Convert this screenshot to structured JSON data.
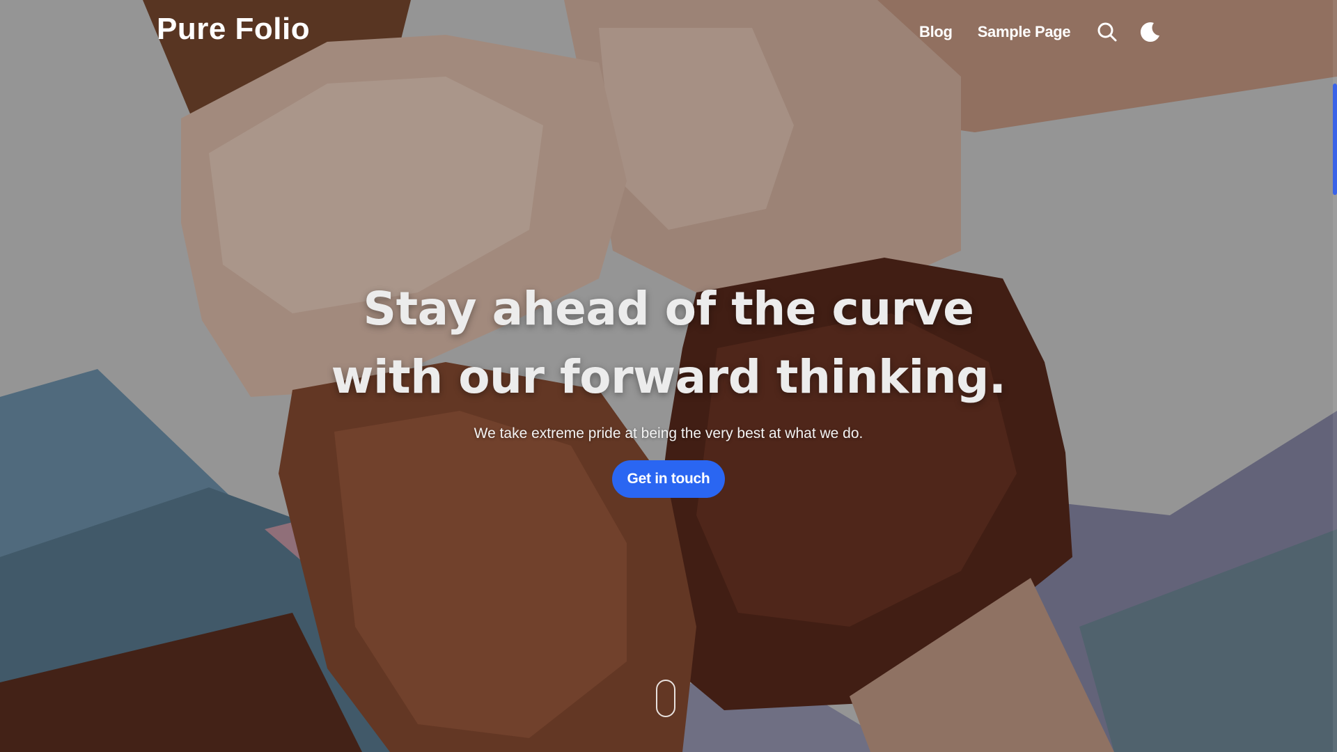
{
  "header": {
    "brand": "Pure Folio",
    "nav": [
      {
        "label": "Blog"
      },
      {
        "label": "Sample Page"
      }
    ],
    "icons": [
      "search-icon",
      "moon-icon"
    ]
  },
  "hero": {
    "title_line_1": "Stay ahead of the curve",
    "title_line_2": "with our forward thinking.",
    "subtitle": "We take extreme pride at being the very best at what we do.",
    "cta_label": "Get in touch"
  },
  "theme": {
    "accent": "#2a66f2",
    "text": "#ffffff"
  }
}
